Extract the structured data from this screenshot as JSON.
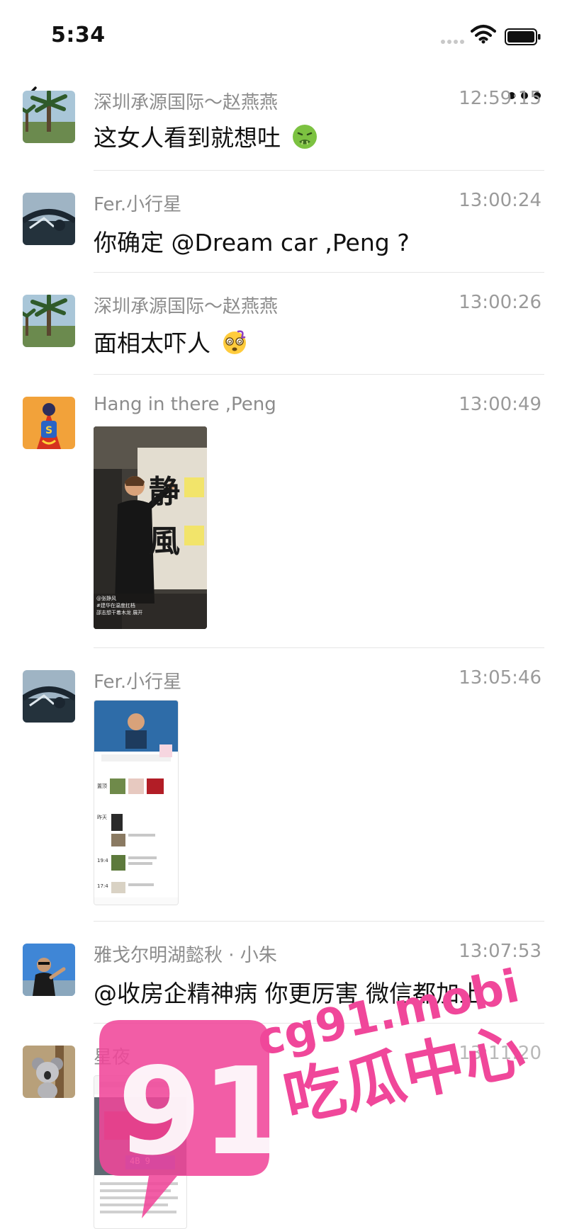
{
  "status_bar": {
    "time": "5:34"
  },
  "icons": {
    "back": "chevron-left-icon",
    "more": "more-dots-icon",
    "wifi": "wifi-icon",
    "battery": "battery-icon"
  },
  "colors": {
    "sender_gray": "#8c8c8c",
    "divider": "#e6e6e6",
    "watermark_pink": "#f0479a"
  },
  "messages": [
    {
      "sender": "深圳承源国际～赵燕燕",
      "time": "12:59:15",
      "text": "这女人看到就想吐",
      "emoji": "nauseated-face"
    },
    {
      "sender": "Fer.小行星",
      "time": "13:00:24",
      "text": "你确定 @Dream car ,Peng ?"
    },
    {
      "sender": "深圳承源国际～赵燕燕",
      "time": "13:00:26",
      "text": "面相太吓人",
      "emoji": "dizzy-face"
    },
    {
      "sender": "Hang in there ,Peng",
      "time": "13:00:49",
      "image": {
        "chars": "静風",
        "caption_lines": [
          "@张静风",
          "#建华在温度扛档",
          "邵志想干着木龙 展开"
        ]
      }
    },
    {
      "sender": "Fer.小行星",
      "time": "13:05:46",
      "image": {
        "labels": [
          "置顶",
          "昨天",
          "19:4",
          "17:4"
        ]
      }
    },
    {
      "sender": "雅戈尔明湖懿秋 · 小朱",
      "time": "13:07:53",
      "text": "@收房企精神病 你更厉害 微信都加上"
    },
    {
      "sender": "星夜",
      "time": "13:11:20",
      "image": {
        "plate": "4B 9"
      }
    }
  ],
  "watermark": {
    "number": "91",
    "url": "cg91.mobi",
    "slogan": "吃瓜中心"
  }
}
